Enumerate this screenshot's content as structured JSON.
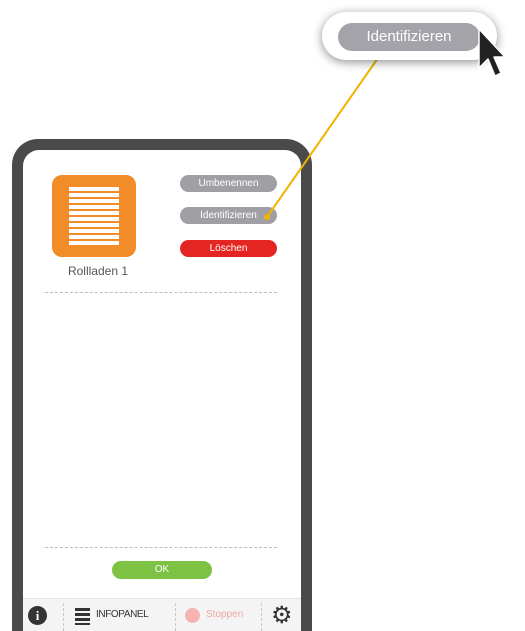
{
  "device": {
    "name": "Rollladen 1",
    "icon": "roller-shutter-icon",
    "tile_color": "#f28c28"
  },
  "actions": {
    "rename_label": "Umbenennen",
    "identify_label": "Identifizieren",
    "delete_label": "Löschen"
  },
  "ok_label": "OK",
  "bottom_bar": {
    "info_icon": "info-icon",
    "info_glyph": "i",
    "infopanel_icon": "list-icon",
    "infopanel_label": "INFOPANEL",
    "stop_icon": "stop-dot-icon",
    "stop_label": "Stoppen",
    "settings_icon": "gear-icon",
    "settings_glyph": "⚙"
  },
  "callout": {
    "label": "Identifizieren"
  },
  "colors": {
    "pill_grey": "#a0a0a4",
    "delete_red": "#e52521",
    "ok_green": "#7dc243",
    "connector": "#f0b400",
    "frame": "#4a4a4a"
  }
}
